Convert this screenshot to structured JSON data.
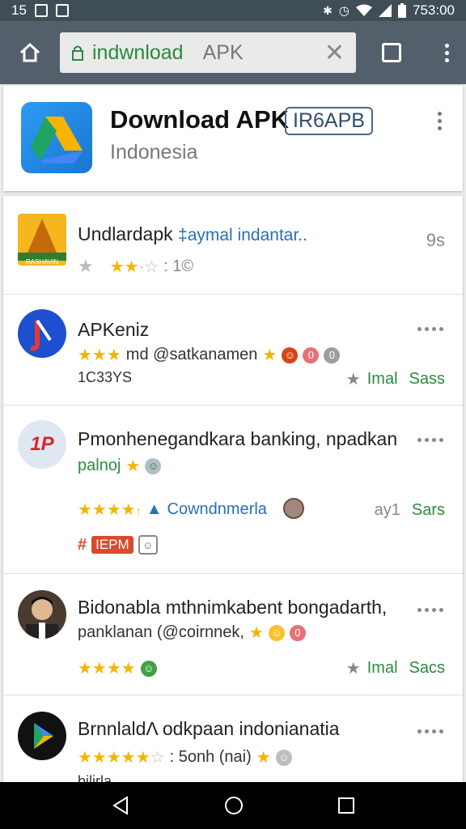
{
  "status": {
    "left_num": "15",
    "time": "753:00"
  },
  "browser": {
    "url_secure": "indwnload",
    "url_rest": "APK",
    "clear": "✕"
  },
  "header": {
    "title": "Download APK",
    "badge": "IR6APB",
    "subtitle": "Indonesia"
  },
  "items": [
    {
      "title": "Undlardapk",
      "title_extra": "‡aymal indantar..",
      "right": "9s",
      "rating_text": ": 1©",
      "icon_text": "RASHAVIN"
    },
    {
      "title": "APKeniz",
      "line2": "md @satkanamen",
      "line3": "1C33YS",
      "right_1": "Imal",
      "right_2": "Sass"
    },
    {
      "title": "Pmonhenegandkara banking, npadkan",
      "line2": "palnoj",
      "line3": "Cowndnmerla",
      "right_1": "ay1",
      "right_2": "Sars",
      "tag_hash": "#",
      "tag": "IEPM",
      "icon_text": "1P"
    },
    {
      "title": "Bidonabla mthnimkabent bongadarth,",
      "line2": "panklanan (@coirnnek,",
      "right_1": "Imal",
      "right_2": "Sacs"
    },
    {
      "title": "BrnnlaldΛ odkpaan indonianatia",
      "line2": ": 5onh (nai)",
      "line3": "bilirla"
    }
  ],
  "colors": {
    "toolbar": "#53606b",
    "statusbar": "#3f4d57",
    "accent_green": "#2e8b3e",
    "star": "#f4b400"
  }
}
